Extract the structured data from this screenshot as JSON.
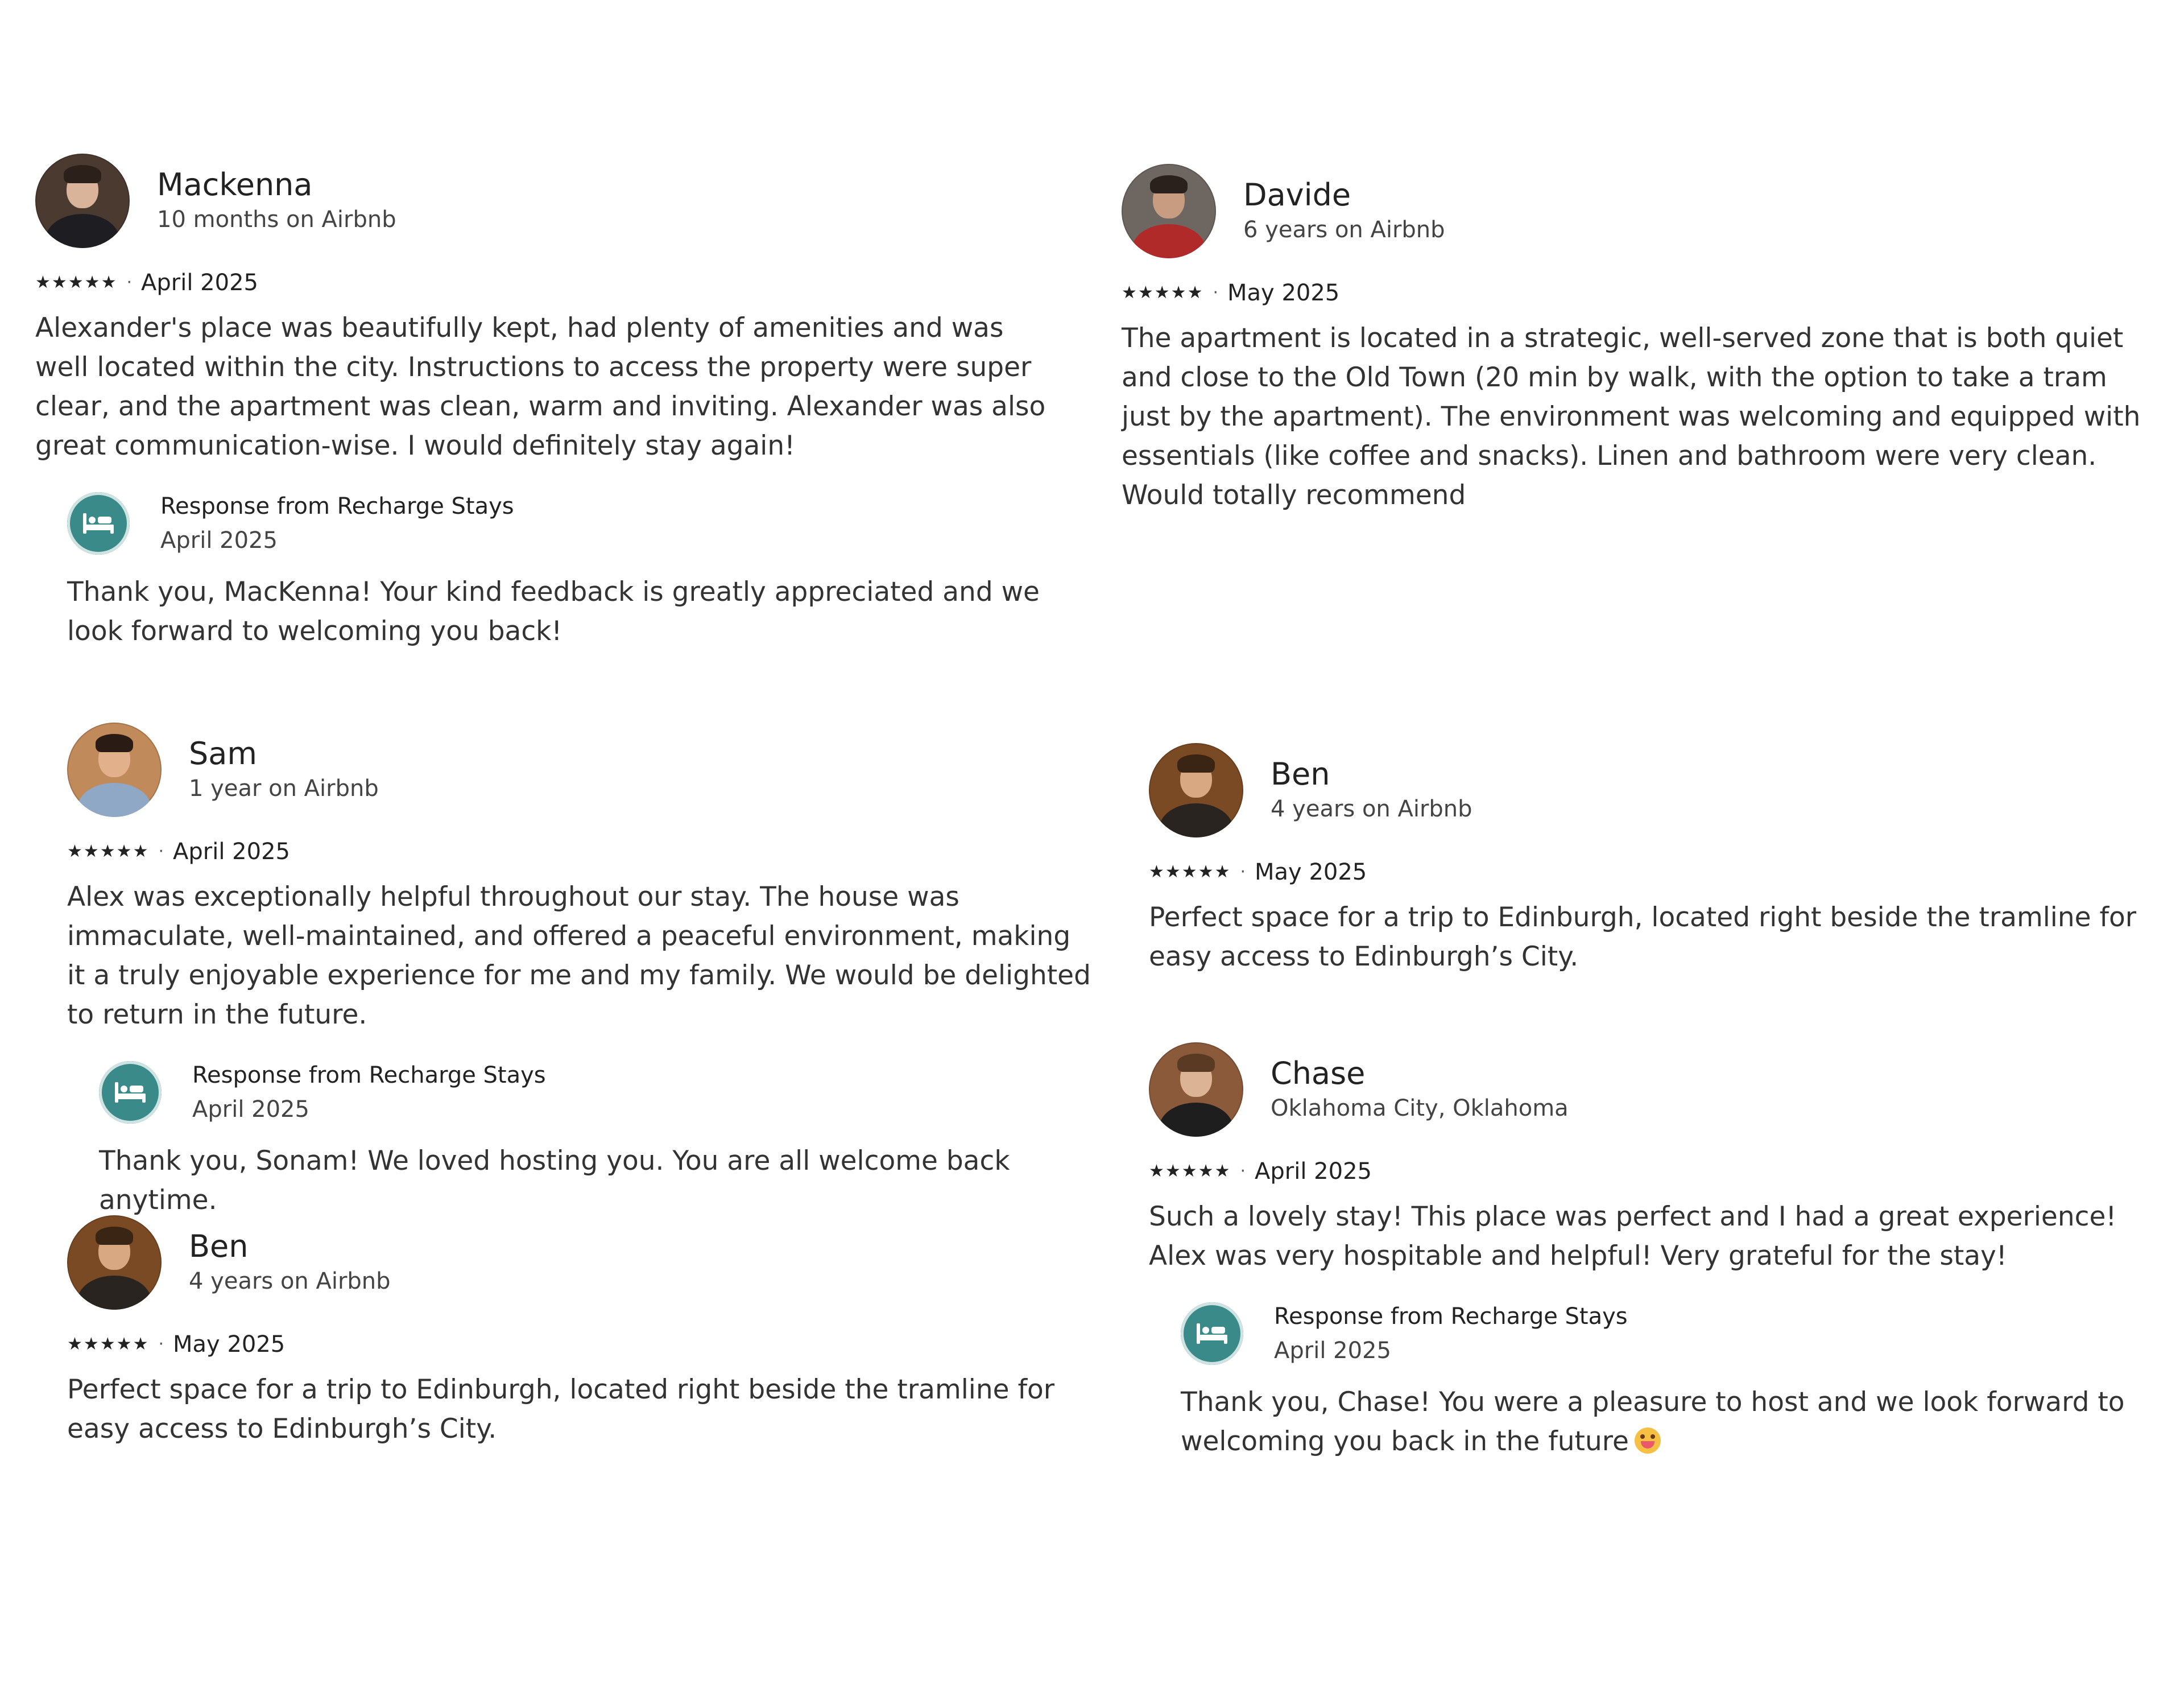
{
  "host_name": "Recharge Stays",
  "reviews": [
    {
      "name": "Mackenna",
      "tenure": "10 months on Airbnb",
      "stars": "★★★★★",
      "date": "April 2025",
      "text": "Alexander's place was beautifully kept, had plenty of amenities and was well located within the city. Instructions to access the property were super clear, and the apartment was clean, warm and inviting. Alexander was also great communication-wise. I would definitely stay again!",
      "avatar_colors": {
        "bg": "#4a3a30",
        "face": "#d9b49a",
        "hair": "#2b201a",
        "body": "#1e1e22"
      },
      "response": {
        "from": "Response from Recharge Stays",
        "date": "April 2025",
        "text": "Thank you, MacKenna! Your kind feedback is greatly appreciated and we look forward to welcoming you back!"
      }
    },
    {
      "name": "Davide",
      "tenure": "6 years on Airbnb",
      "stars": "★★★★★",
      "date": "May 2025",
      "text": "The apartment is located in a strategic, well-served zone that is both quiet and close to the Old Town (20 min by walk, with the option to take a tram just by the apartment). The environment was welcoming and equipped with essentials (like coffee and snacks). Linen and bathroom were very clean. Would totally recommend",
      "avatar_colors": {
        "bg": "#6e6660",
        "face": "#c89c80",
        "hair": "#2a211c",
        "body": "#b02a2a"
      }
    },
    {
      "name": "Sam",
      "tenure": "1 year on Airbnb",
      "stars": "★★★★★",
      "date": "April 2025",
      "text": "Alex was exceptionally helpful throughout our stay. The house was immaculate, well-maintained, and offered a peaceful environment, making it a truly enjoyable experience for me and my family. We would be delighted to return in the future.",
      "avatar_colors": {
        "bg": "#c08a5a",
        "face": "#e3b08c",
        "hair": "#2a1c14",
        "body": "#8fa8c6"
      },
      "response": {
        "from": "Response from Recharge Stays",
        "date": "April 2025",
        "text": "Thank you, Sonam! We loved hosting you. You are all welcome back anytime."
      }
    },
    {
      "name": "Ben",
      "tenure": "4 years on Airbnb",
      "stars": "★★★★★",
      "date": "May 2025",
      "text": "Perfect space for a trip to Edinburgh, located right beside the tramline for easy access to Edinburgh’s City.",
      "avatar_colors": {
        "bg": "#7a4a24",
        "face": "#d7a882",
        "hair": "#3a2414",
        "body": "#2a2420"
      }
    },
    {
      "name": "Chase",
      "tenure": "Oklahoma City, Oklahoma",
      "stars": "★★★★★",
      "date": "April 2025",
      "text": "Such a lovely stay! This place was perfect and I had a great experience! Alex was very hospitable and helpful! Very grateful for the stay!",
      "avatar_colors": {
        "bg": "#8a5a3a",
        "face": "#dcb394",
        "hair": "#5a3a22",
        "body": "#1e1e1e"
      },
      "response": {
        "from": "Response from Recharge Stays",
        "date": "April 2025",
        "text": "Thank you, Chase! You were a pleasure to host and we look forward to welcoming you back in the future"
      }
    },
    {
      "name": "Ben",
      "tenure": "4 years on Airbnb",
      "stars": "★★★★★",
      "date": "May 2025",
      "text": "Perfect space for a trip to Edinburgh, located right beside the tramline for easy access to Edinburgh’s City.",
      "avatar_colors": {
        "bg": "#7a4a24",
        "face": "#d7a882",
        "hair": "#3a2414",
        "body": "#2a2420"
      }
    }
  ]
}
